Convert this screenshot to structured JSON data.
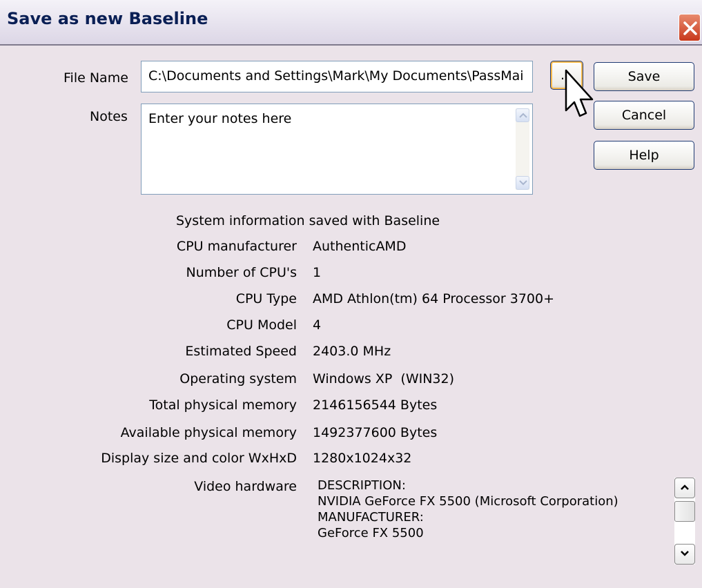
{
  "window": {
    "title": "Save as new Baseline"
  },
  "form": {
    "file_name_label": "File Name",
    "file_name_value": "C:\\Documents and Settings\\Mark\\My Documents\\PassMai",
    "notes_label": "Notes",
    "notes_value": "Enter your notes here"
  },
  "buttons": {
    "browse": "...",
    "save": "Save",
    "cancel": "Cancel",
    "help": "Help"
  },
  "sysinfo": {
    "heading": "System information saved with Baseline",
    "rows": [
      {
        "label": "CPU manufacturer",
        "value": "AuthenticAMD"
      },
      {
        "label": "Number of CPU's",
        "value": "1"
      },
      {
        "label": "CPU Type",
        "value": "AMD Athlon(tm) 64 Processor 3700+"
      },
      {
        "label": "CPU Model",
        "value": "4"
      },
      {
        "label": "Estimated Speed",
        "value": "2403.0 MHz"
      },
      {
        "label": "Operating system",
        "value": "Windows XP  (WIN32)"
      },
      {
        "label": "Total physical memory",
        "value": "2146156544 Bytes"
      },
      {
        "label": "Available physical memory",
        "value": "1492377600 Bytes"
      },
      {
        "label": "Display size and color WxHxD",
        "value": "1280x1024x32"
      }
    ],
    "video_label": "Video hardware",
    "video_lines": [
      "DESCRIPTION:",
      "NVIDIA GeForce FX 5500 (Microsoft Corporation)",
      "MANUFACTURER:",
      "GeForce FX 5500"
    ]
  },
  "colors": {
    "titlebar_text": "#0a1f55",
    "close_button": "#c8391c",
    "dialog_bg": "#ebe3e9"
  },
  "icons": {
    "close": "close-icon",
    "cursor": "mouse-pointer-icon"
  }
}
